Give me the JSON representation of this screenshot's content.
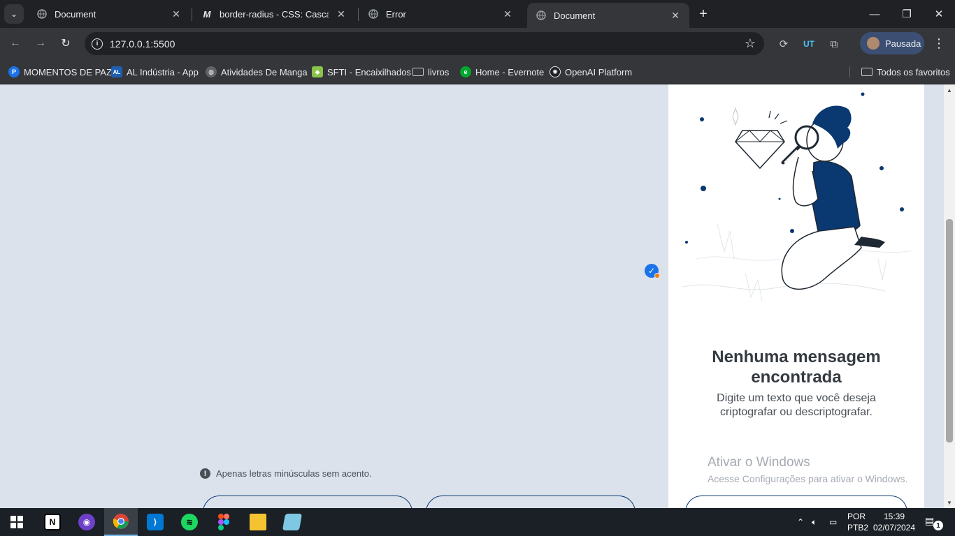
{
  "browser": {
    "tabs": [
      {
        "title": "Document",
        "icon": "globe-icon"
      },
      {
        "title": "border-radius - CSS: Cascading",
        "icon": "mdn-icon"
      },
      {
        "title": "Error",
        "icon": "globe-icon"
      },
      {
        "title": "Document",
        "icon": "globe-icon",
        "active": true
      }
    ],
    "url": "127.0.0.1:5500",
    "profile_label": "Pausada",
    "bookmarks": [
      {
        "label": "MOMENTOS DE PAZ",
        "icon": "p-icon",
        "color": "#1a73e8"
      },
      {
        "label": "AL Indústria - App",
        "icon": "al-icon",
        "color": "#1e5fb4"
      },
      {
        "label": "Atividades De Manga",
        "icon": "globe-icon",
        "color": "#5f6368"
      },
      {
        "label": "SFTI - Encaixilhados",
        "icon": "shield-icon",
        "color": "#8bc34a"
      },
      {
        "label": "livros",
        "icon": "folder-icon",
        "color": ""
      },
      {
        "label": "Home - Evernote",
        "icon": "evernote-icon",
        "color": "#00a82d"
      },
      {
        "label": "OpenAI Platform",
        "icon": "openai-icon",
        "color": "#202124"
      }
    ],
    "all_bookmarks_label": "Todos os favoritos"
  },
  "page": {
    "hint": "Apenas letras minúsculas sem acento.",
    "panel": {
      "title": "Nenhuma mensagem encontrada",
      "subtitle": "Digite um texto que você deseja criptografar ou descriptografar."
    },
    "accent_color": "#0a3871"
  },
  "watermark": {
    "title": "Ativar o Windows",
    "subtitle": "Acesse Configurações para ativar o Windows."
  },
  "taskbar": {
    "apps": [
      "windows-start-icon",
      "notion-icon",
      "github-icon",
      "chrome-icon",
      "vscode-icon",
      "spotify-icon",
      "figma-icon",
      "file-explorer-icon",
      "notepad-icon"
    ],
    "lang_line1": "POR",
    "lang_line2": "PTB2",
    "time": "15:39",
    "date": "02/07/2024",
    "notification_count": "1"
  }
}
